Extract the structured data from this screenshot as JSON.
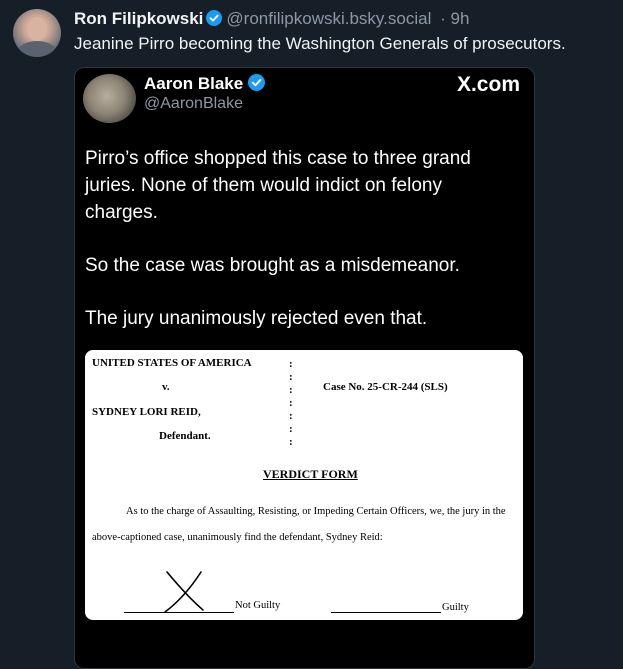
{
  "post": {
    "author_name": "Ron Filipkowski",
    "author_handle": "@ronfilipkowski.bsky.social",
    "separator": "·",
    "time_ago": "9h",
    "text": "Jeanine Pirro becoming the Washington Generals of prosecutors."
  },
  "embed": {
    "author_name": "Aaron Blake",
    "author_handle": "@AaronBlake",
    "source": "X.com",
    "paragraphs": [
      "Pirro’s office shopped this case to three grand juries. None of them would indict on felony charges.",
      "So the case was brought as a misdemeanor.",
      "The jury unanimously rejected even that."
    ]
  },
  "document": {
    "plaintiff": "UNITED STATES OF AMERICA",
    "versus": "v.",
    "case_no": "Case No. 25-CR-244 (SLS)",
    "defendant": "SYDNEY LORI REID,",
    "defendant_label": "Defendant.",
    "title": "VERDICT FORM",
    "line1": "As to the charge of Assaulting, Resisting, or Impeding Certain Officers, we, the jury in the",
    "line2": "above-captioned case, unanimously find the defendant, Sydney Reid:",
    "not_guilty_label": "Not Guilty",
    "guilty_label": "Guilty",
    "selected": "Not Guilty"
  },
  "colors": {
    "background": "#161e27",
    "verified_blue": "#1d9bf0",
    "muted": "#8b98a5"
  },
  "icons": {
    "verified": "verified-badge-icon"
  }
}
